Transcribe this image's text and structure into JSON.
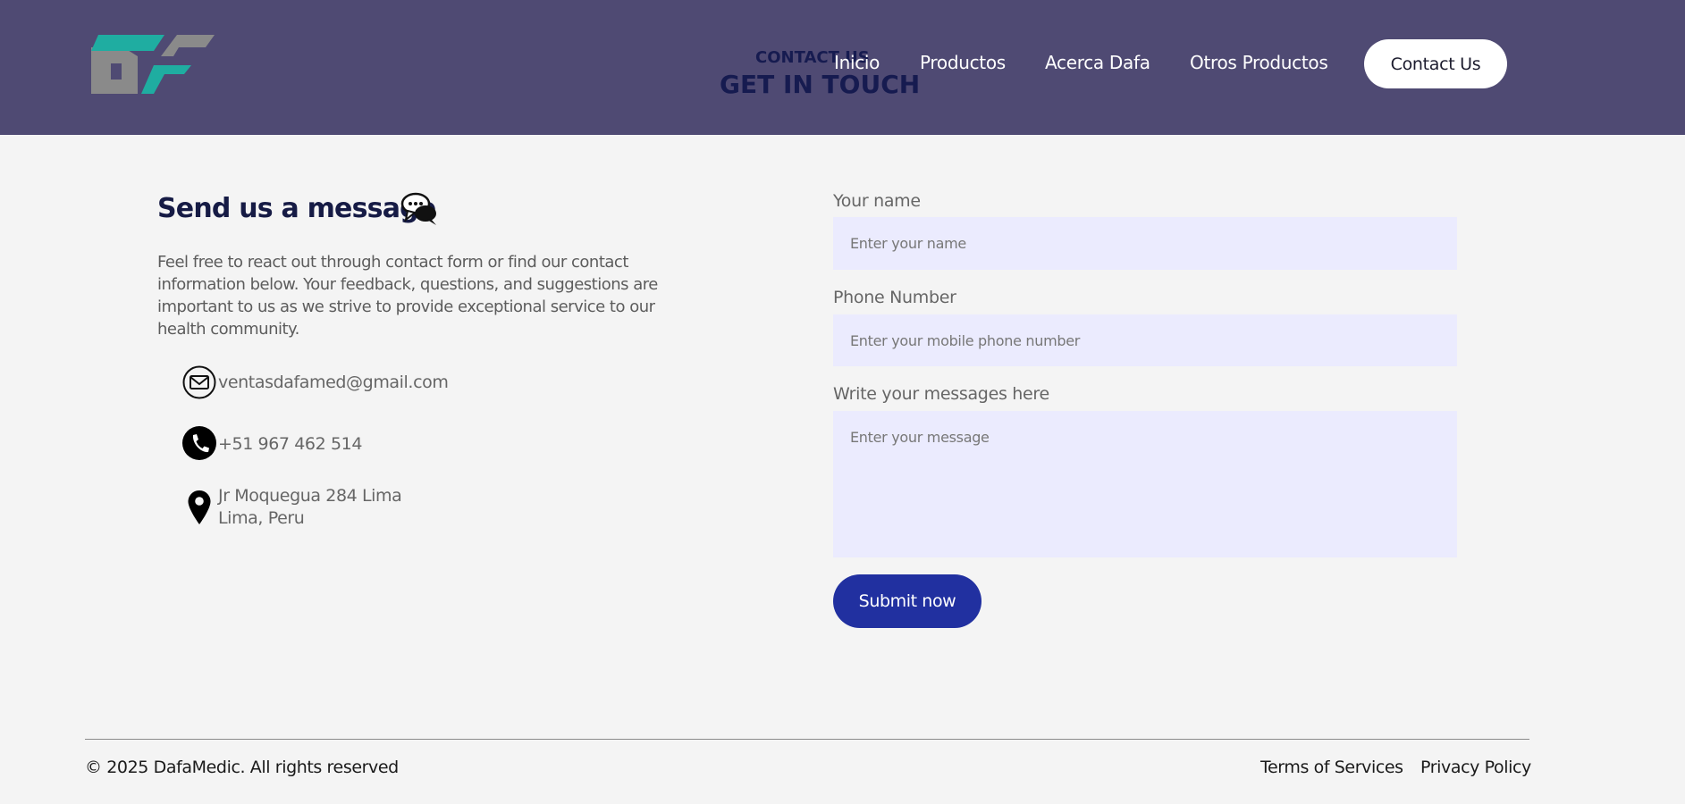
{
  "header": {
    "hero_small": "CONTACT US",
    "hero_big": "GET IN TOUCH",
    "nav": [
      "Inicio",
      "Productos",
      "Acerca Dafa",
      "Otros Productos"
    ],
    "cta": "Contact Us",
    "logo_icon": "df-logo"
  },
  "message": {
    "title": "Send us a message",
    "title_icon": "chat-bubbles-icon",
    "intro": "Feel free to react out through contact form or find our contact information below. Your feedback, questions, and suggestions are important to us as we strive to provide exceptional service to our health community.",
    "email": "ventasdafamed@gmail.com",
    "phone": "+51 967 462 514",
    "address_line1": "Jr Moquegua 284 Lima",
    "address_line2": "Lima, Peru"
  },
  "form": {
    "name_label": "Your name",
    "name_placeholder": "Enter your name",
    "phone_label": "Phone Number",
    "phone_placeholder": "Enter your mobile phone number",
    "message_label": "Write your messages here",
    "message_placeholder": "Enter your message",
    "submit": "Submit now"
  },
  "footer": {
    "copyright": "© 2025 DafaMedic. All rights reserved",
    "terms": "Terms of Services",
    "privacy": "Privacy Policy"
  },
  "colors": {
    "header_bg": "#4f4a73",
    "logo_teal": "#1fada1",
    "logo_gray": "#8a8a8a",
    "submit_bg": "#2130a0",
    "field_bg": "#ebebfe"
  }
}
